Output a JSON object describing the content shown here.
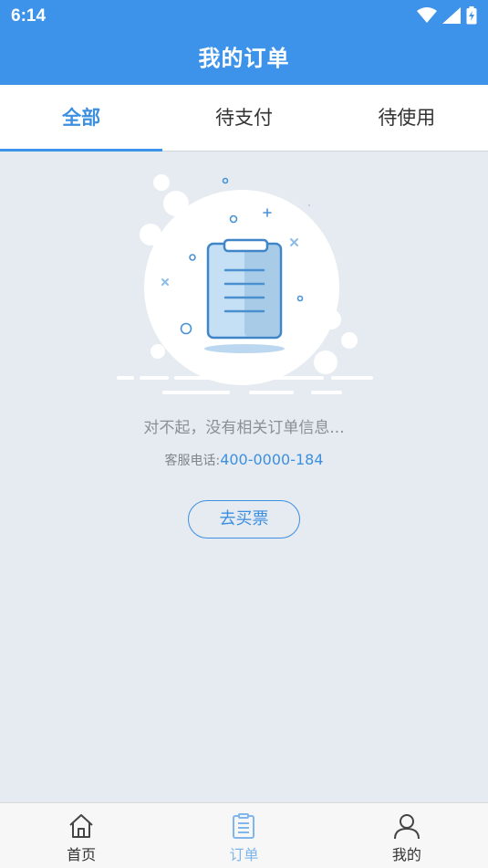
{
  "status_bar": {
    "time": "6:14",
    "icons": [
      "wifi-icon",
      "signal-icon",
      "battery-icon"
    ]
  },
  "header": {
    "title": "我的订单"
  },
  "tabs": [
    {
      "label": "全部",
      "active": true
    },
    {
      "label": "待支付",
      "active": false
    },
    {
      "label": "待使用",
      "active": false
    }
  ],
  "empty_state": {
    "message": "对不起，没有相关订单信息...",
    "service_label": "客服电话:",
    "service_phone": "400-0000-184",
    "action_label": "去买票"
  },
  "bottom_nav": [
    {
      "label": "首页",
      "icon": "home-icon",
      "active": false
    },
    {
      "label": "订单",
      "icon": "order-list-icon",
      "active": true
    },
    {
      "label": "我的",
      "icon": "user-icon",
      "active": false
    }
  ],
  "colors": {
    "primary": "#3d93ea",
    "accent_text": "#3d8fe0",
    "background": "#e5ebf0",
    "nav_active": "#7fb6ec"
  }
}
